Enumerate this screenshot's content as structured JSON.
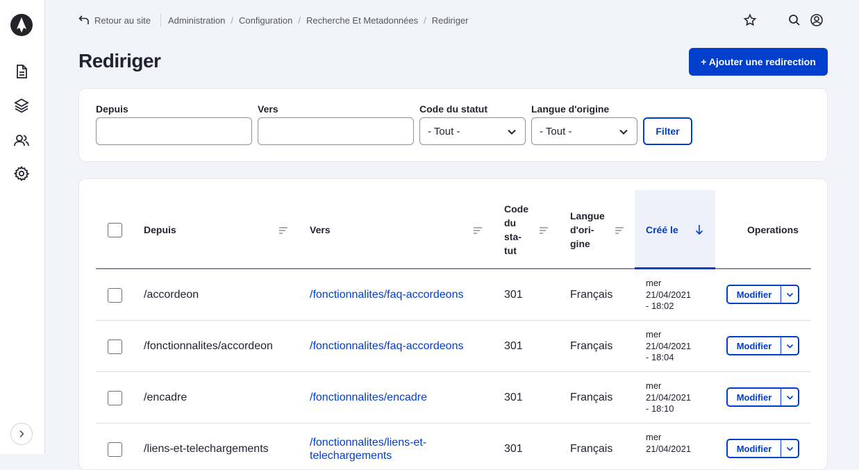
{
  "sidebar": {
    "logo": "drupal-logo-icon",
    "icons": [
      "file-icon",
      "layers-icon",
      "people-icon",
      "gear-icon"
    ],
    "expand": "chevron-right-icon"
  },
  "topbar": {
    "back_label": "Retour au site",
    "breadcrumbs": [
      "Administration",
      "Configuration",
      "Recherche Et Metadonnées",
      "Rediriger"
    ],
    "icons": [
      "star-icon",
      "search-icon",
      "user-icon"
    ]
  },
  "page": {
    "title": "Rediriger",
    "add_button": "+ Ajouter une redirection"
  },
  "filters": {
    "from_label": "Depuis",
    "from_value": "",
    "to_label": "Vers",
    "to_value": "",
    "status_label": "Code du statut",
    "status_value": "- Tout -",
    "lang_label": "Langue d'origine",
    "lang_value": "- Tout -",
    "submit": "Filter"
  },
  "table": {
    "headers": {
      "from": "Depuis",
      "to": "Vers",
      "status": "Code du sta-tut",
      "status_lines": [
        "Code",
        "du",
        "sta-",
        "tut"
      ],
      "lang_lines": [
        "Langue",
        "d'ori-",
        "gine"
      ],
      "created": "Créé le",
      "operations": "Operations"
    },
    "rows": [
      {
        "from": "/accordeon",
        "to": "/fonctionnalites/faq-accordeons",
        "to_line2": "",
        "status": "301",
        "lang": "Français",
        "date_l1": "mer",
        "date_l2": "21/04/2021",
        "date_l3": "- 18:02",
        "op": "Modifier"
      },
      {
        "from": "/fonctionnalites/accordeon",
        "to": "/fonctionnalites/faq-accordeons",
        "to_line2": "",
        "status": "301",
        "lang": "Français",
        "date_l1": "mer",
        "date_l2": "21/04/2021",
        "date_l3": "- 18:04",
        "op": "Modifier"
      },
      {
        "from": "/encadre",
        "to": "/fonctionnalites/encadre",
        "to_line2": "",
        "status": "301",
        "lang": "Français",
        "date_l1": "mer",
        "date_l2": "21/04/2021",
        "date_l3": "- 18:10",
        "op": "Modifier"
      },
      {
        "from": "/liens-et-telechargements",
        "to": "/fonctionnalites/liens-et-",
        "to_line2": "telechargements",
        "status": "301",
        "lang": "Français",
        "date_l1": "mer",
        "date_l2": "21/04/2021",
        "date_l3": "",
        "op": "Modifier"
      }
    ]
  },
  "colors": {
    "primary": "#003ecc",
    "sidebar_bg": "#ffffff",
    "page_bg": "#f3f4f9"
  }
}
